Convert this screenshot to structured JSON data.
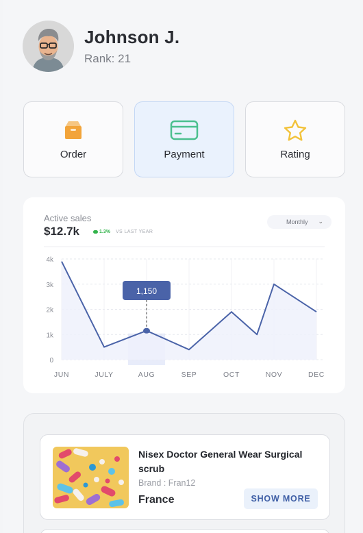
{
  "profile": {
    "name": "Johnson J.",
    "rank": "Rank: 21"
  },
  "actions": [
    {
      "label": "Order",
      "icon": "box-icon",
      "color": "#f2a43a"
    },
    {
      "label": "Payment",
      "icon": "card-icon",
      "color": "#4bbf8e",
      "active": true
    },
    {
      "label": "Rating",
      "icon": "star-icon",
      "color": "#f2c23a"
    }
  ],
  "sales": {
    "label": "Active sales",
    "value": "$12.7k",
    "growth": "1.3%",
    "comparison": "VS LAST YEAR",
    "period": "Monthly"
  },
  "chart_data": {
    "type": "area",
    "categories": [
      "JUN",
      "JULY",
      "AUG",
      "SEP",
      "OCT",
      "NOV",
      "DEC"
    ],
    "y_ticks": [
      "4k",
      "3k",
      "2k",
      "1k",
      "0"
    ],
    "ylim": [
      0,
      4000
    ],
    "grid": true,
    "highlighted_category": "AUG",
    "tooltip": "1,150",
    "series": [
      {
        "x": [
          0,
          1,
          2,
          3,
          4,
          4.6,
          5,
          6
        ],
        "values": [
          3900,
          500,
          1150,
          400,
          1900,
          1000,
          3000,
          1900
        ],
        "color": "#4a63a8"
      }
    ]
  },
  "products": [
    {
      "title": "Nisex Doctor General Wear Surgical scrub",
      "brand": "Brand : Fran12",
      "country": "France",
      "cta": "SHOW MORE"
    }
  ],
  "colors": {
    "accent": "#4a63a8",
    "active_card": "#eaf2fd",
    "growth": "#31b34a"
  }
}
